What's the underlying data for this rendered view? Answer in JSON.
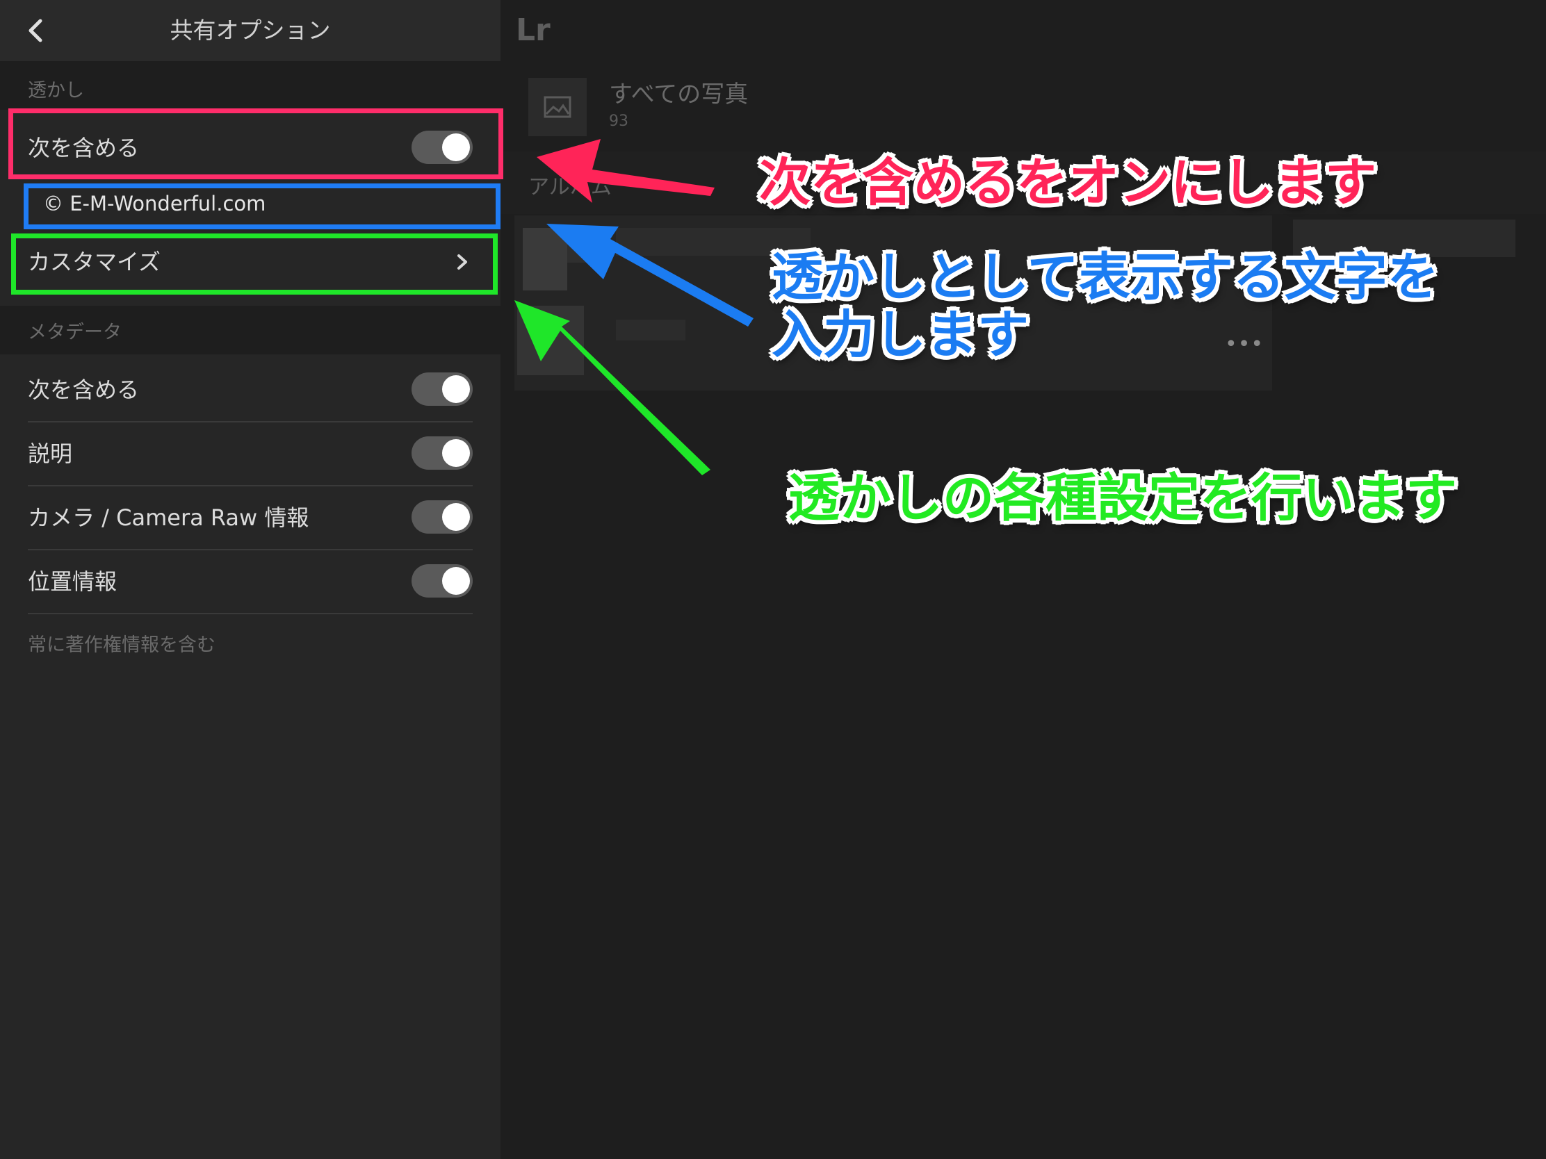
{
  "header": {
    "title": "共有オプション",
    "back_icon": "chevron-left-icon"
  },
  "watermark_section": {
    "label": "透かし",
    "include_label": "次を含める",
    "include_on": true,
    "text_value": "© E-M-Wonderful.com",
    "customize_label": "カスタマイズ"
  },
  "metadata_section": {
    "label": "メタデータ",
    "items": [
      {
        "label": "次を含める",
        "on": true
      },
      {
        "label": "説明",
        "on": true
      },
      {
        "label": "カメラ / Camera Raw 情報",
        "on": true
      },
      {
        "label": "位置情報",
        "on": true
      }
    ],
    "footnote": "常に著作権情報を含む"
  },
  "library": {
    "logo": "Lr",
    "all_photos_label": "すべての写真",
    "all_photos_count": "93",
    "album_label": "アルバム"
  },
  "annotations": {
    "red": "次を含めるをオンにします",
    "blue_line1": "透かしとして表示する文字を",
    "blue_line2": "入力します",
    "green": "透かしの各種設定を行います"
  },
  "colors": {
    "red": "#ff2d6a",
    "blue": "#1f7cf5",
    "green": "#1fe629"
  }
}
